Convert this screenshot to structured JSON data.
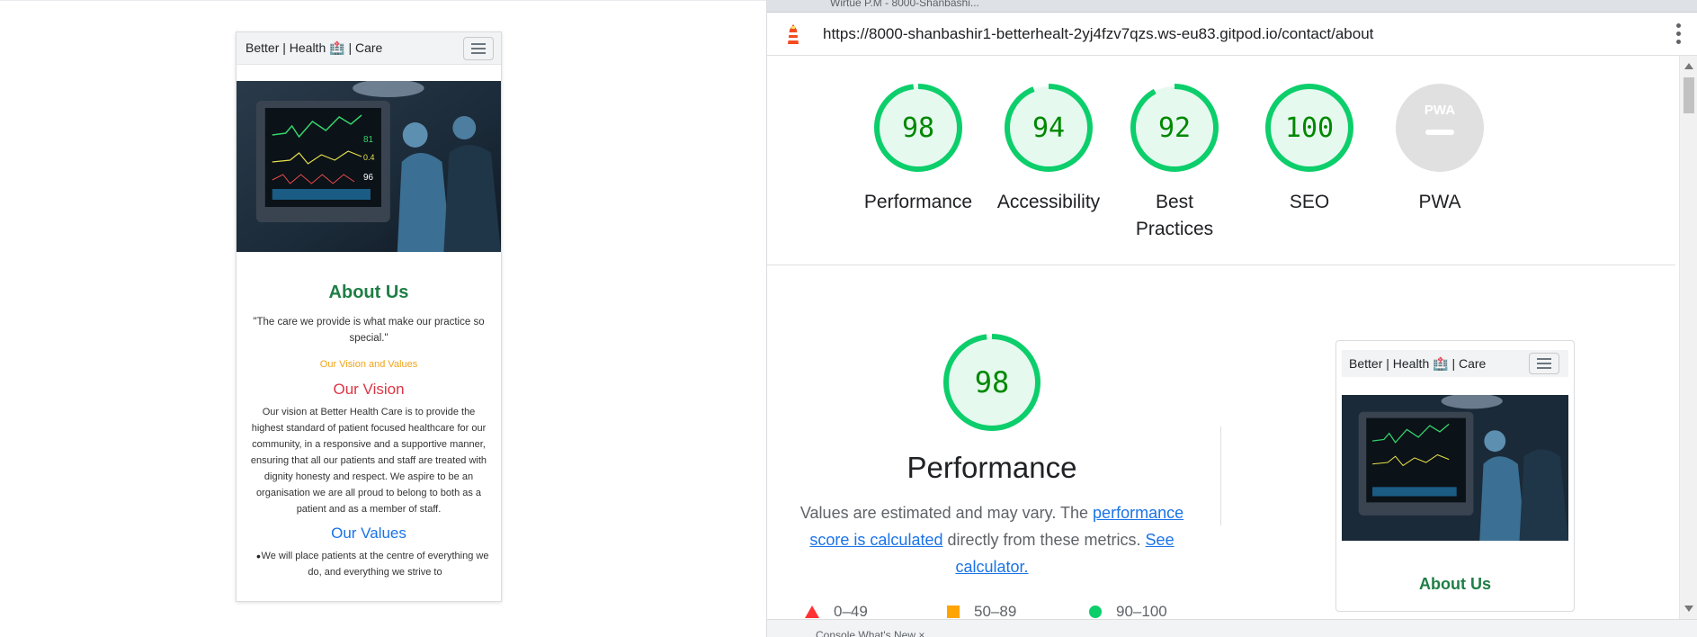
{
  "left": {
    "brand": "Better | Health 🏥 | Care",
    "about_title": "About Us",
    "quote": "\"The care we provide is what make our practice so special.\"",
    "vision_values": "Our Vision and Values",
    "vision_title": "Our Vision",
    "vision_text": "Our vision at Better Health Care is to provide the highest standard of patient focused healthcare for our community, in a responsive and a supportive manner, ensuring that all our patients and staff are treated with dignity honesty and respect. We aspire to be an organisation we are all proud to belong to both as a patient and as a member of staff.",
    "values_title": "Our Values",
    "values_items": [
      "We will place patients at the centre of everything we do, and everything we strive to"
    ]
  },
  "right": {
    "tab_text": "Wirtue P.M - 8000-Shanbashi...",
    "url": "https://8000-shanbashir1-betterhealt-2yj4fzv7qzs.ws-eu83.gitpod.io/contact/about",
    "scores": [
      {
        "label": "Performance",
        "value": "98",
        "fraction": 0.98
      },
      {
        "label": "Accessibility",
        "value": "94",
        "fraction": 0.94
      },
      {
        "label": "Best Practices",
        "value": "92",
        "fraction": 0.92
      },
      {
        "label": "SEO",
        "value": "100",
        "fraction": 1.0
      },
      {
        "label": "PWA",
        "value": "",
        "fraction": 0
      }
    ],
    "pwa_badge": "PWA",
    "performance": {
      "score": "98",
      "fraction": 0.98,
      "title": "Performance",
      "desc_prefix": "Values are estimated and may vary. The ",
      "link1": "performance score is calculated",
      "desc_middle": " directly from these metrics. ",
      "link2": "See calculator."
    },
    "legend": [
      {
        "shape": "triangle",
        "range": "0–49",
        "color": "#ff3333"
      },
      {
        "shape": "square",
        "range": "50–89",
        "color": "#ffa400"
      },
      {
        "shape": "circle",
        "range": "90–100",
        "color": "#0cce6b"
      }
    ],
    "thumbnail": {
      "brand": "Better | Health 🏥 | Care",
      "about_title": "About Us"
    },
    "bottom_text": "Console   What's New   ×"
  },
  "colors": {
    "pass": "#0cce6b",
    "pass_text": "#008800",
    "pass_fill": "#e6f9ef",
    "pwa_gray": "#e0e0e0",
    "link": "#1a73e8"
  }
}
